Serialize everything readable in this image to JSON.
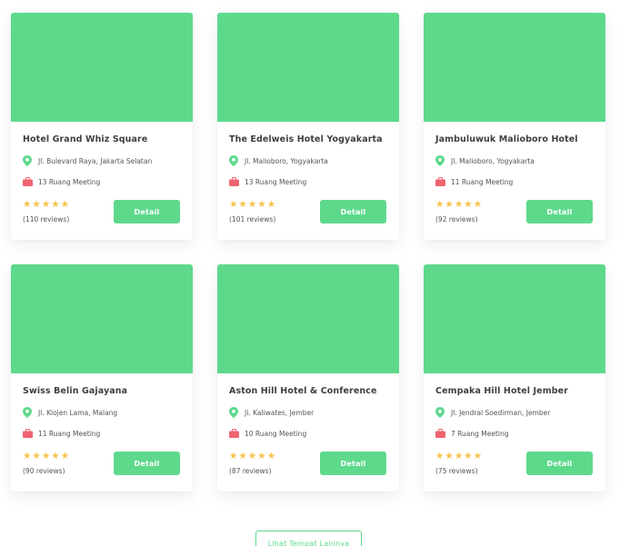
{
  "theme": {
    "accent": "#5ed98c",
    "star": "#f5c24a",
    "pin": "#5ed98c",
    "briefcase": "#ef6470"
  },
  "hotels": [
    {
      "name": "Hotel Grand Whiz Square",
      "address": "Jl. Bulevard Raya, Jakarta Selatan",
      "meeting": "13 Ruang Meeting",
      "rating": 5,
      "reviews": "(110 reviews)",
      "button": "Detail"
    },
    {
      "name": "The Edelweis Hotel Yogyakarta",
      "address": "Jl. Malioboro, Yogyakarta",
      "meeting": "13 Ruang Meeting",
      "rating": 5,
      "reviews": "(101 reviews)",
      "button": "Detail"
    },
    {
      "name": "Jambuluwuk Malioboro Hotel",
      "address": "Jl. Malioboro, Yogyakarta",
      "meeting": "11 Ruang Meeting",
      "rating": 5,
      "reviews": "(92 reviews)",
      "button": "Detail"
    },
    {
      "name": "Swiss Belin Gajayana",
      "address": "Jl. Klojen Lama, Malang",
      "meeting": "11 Ruang Meeting",
      "rating": 5,
      "reviews": "(90 reviews)",
      "button": "Detail"
    },
    {
      "name": "Aston Hill Hotel & Conference",
      "address": "Jl. Kaliwates, Jember",
      "meeting": "10 Ruang Meeting",
      "rating": 5,
      "reviews": "(87 reviews)",
      "button": "Detail"
    },
    {
      "name": "Cempaka Hill Hotel Jember",
      "address": "Jl. Jendral Soedirman, Jember",
      "meeting": "7 Ruang Meeting",
      "rating": 5,
      "reviews": "(75 reviews)",
      "button": "Detail"
    }
  ],
  "load_more": {
    "label": "Lihat Tempat Lainnya"
  },
  "icons": {
    "location": "map-pin-icon",
    "meeting": "briefcase-icon",
    "rating": "star-icon"
  }
}
